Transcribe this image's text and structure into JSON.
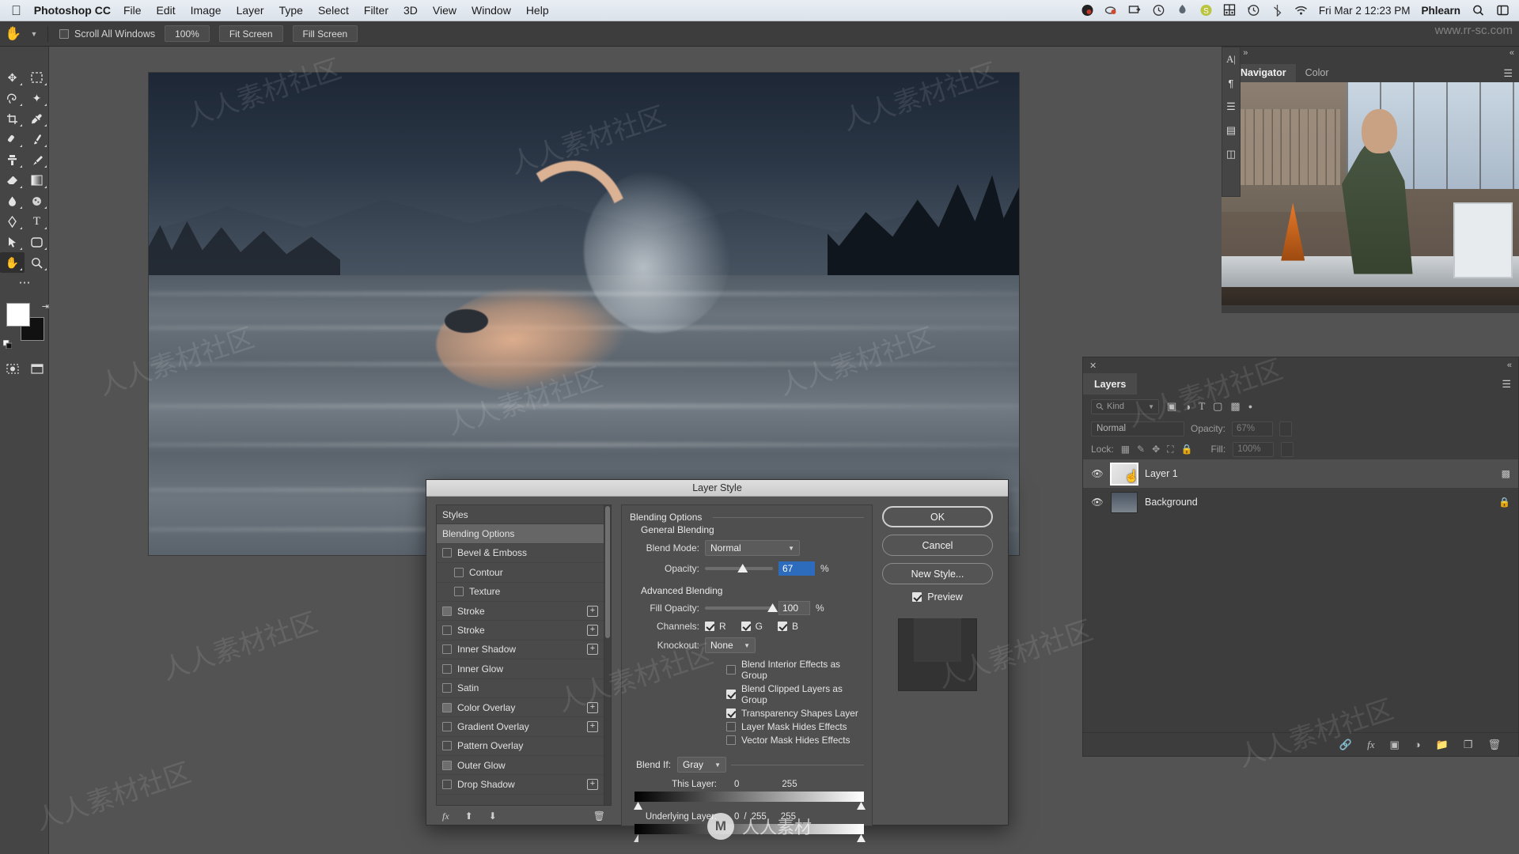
{
  "menubar": {
    "apple_icon": "apple-icon",
    "app_name": "Photoshop CC",
    "items": [
      "File",
      "Edit",
      "Image",
      "Layer",
      "Type",
      "Select",
      "Filter",
      "3D",
      "View",
      "Window",
      "Help"
    ],
    "status_icons": [
      "dropbox-icon",
      "cloud-sync-icon",
      "display-icon",
      "clock-icon",
      "battery-icon",
      "skype-icon",
      "grid-icon",
      "time-machine-icon",
      "bluetooth-icon",
      "wifi-icon"
    ],
    "clock": "Fri Mar 2  12:23 PM",
    "user": "Phlearn",
    "trailing_icons": [
      "search-icon",
      "control-center-icon"
    ]
  },
  "options_bar": {
    "tool_icon": "hand-tool-icon",
    "caret_icon": "chevron-down-icon",
    "scroll_all_windows": {
      "label": "Scroll All Windows",
      "checked": false
    },
    "buttons": [
      "100%",
      "Fit Screen",
      "Fill Screen"
    ]
  },
  "toolbar": {
    "tools": [
      "move-tool-icon",
      "marquee-tool-icon",
      "lasso-tool-icon",
      "magic-wand-tool-icon",
      "crop-tool-icon",
      "eyedropper-tool-icon",
      "healing-brush-tool-icon",
      "brush-tool-icon",
      "clone-stamp-tool-icon",
      "history-brush-tool-icon",
      "eraser-tool-icon",
      "gradient-tool-icon",
      "blur-tool-icon",
      "dodge-tool-icon",
      "pen-tool-icon",
      "type-tool-icon",
      "path-selection-tool-icon",
      "rectangle-tool-icon",
      "hand-tool-icon",
      "zoom-tool-icon"
    ],
    "active_tool": "hand-tool-icon",
    "more_tools_icon": "ellipsis-icon",
    "foreground_color": "#ffffff",
    "background_color": "#111111",
    "swap_colors_icon": "swap-colors-icon",
    "default_colors_icon": "default-colors-icon",
    "quick_mask_icon": "quick-mask-icon",
    "screen_mode_icon": "screen-mode-icon"
  },
  "navigator_panel": {
    "close_icon": "close-icon",
    "expand_icon": "expand-icon",
    "collapse_icon": "collapse-panel-icon",
    "tabs": [
      {
        "label": "Navigator",
        "selected": true
      },
      {
        "label": "Color",
        "selected": false
      }
    ],
    "menu_icon": "panel-menu-icon",
    "rail_icons": [
      "character-icon",
      "paragraph-icon",
      "layer-comps-icon",
      "properties-icon",
      "adjustments-icon"
    ]
  },
  "layers_panel": {
    "close_icon": "close-icon",
    "collapse_icon": "collapse-panel-icon",
    "tab_label": "Layers",
    "menu_icon": "panel-menu-icon",
    "filter": {
      "search_icon": "search-icon",
      "kind_label": "Kind",
      "caret_icon": "chevron-down-icon",
      "filter_icons": [
        "pixel-filter-icon",
        "adjustment-filter-icon",
        "type-filter-icon",
        "shape-filter-icon",
        "smart-object-filter-icon"
      ],
      "toggle_icon": "filter-toggle-icon"
    },
    "blend_mode": "Normal",
    "opacity_label": "Opacity:",
    "opacity_value": "67%",
    "lock_label": "Lock:",
    "lock_icons": [
      "lock-transparency-icon",
      "lock-image-icon",
      "lock-position-icon",
      "lock-artboard-icon",
      "lock-all-icon"
    ],
    "fill_label": "Fill:",
    "fill_value": "100%",
    "layers": [
      {
        "name": "Layer 1",
        "visible_icon": "eye-icon",
        "selected": true,
        "right_icon": "smart-object-badge-icon"
      },
      {
        "name": "Background",
        "visible_icon": "eye-icon",
        "selected": false,
        "right_icon": "lock-icon"
      }
    ],
    "bottom_icons": [
      "link-layers-icon",
      "layer-fx-icon",
      "add-mask-icon",
      "adjustment-layer-icon",
      "new-group-icon",
      "new-layer-icon",
      "delete-layer-icon"
    ],
    "cursor_icon": "pointing-hand-cursor-icon"
  },
  "layer_style_dialog": {
    "title": "Layer Style",
    "styles_header": "Styles",
    "styles_list": [
      {
        "label": "Blending Options",
        "type": "header-selected",
        "checkbox": null,
        "plus": false,
        "indent": false
      },
      {
        "label": "Bevel & Emboss",
        "checkbox": false,
        "plus": false,
        "indent": false
      },
      {
        "label": "Contour",
        "checkbox": false,
        "plus": false,
        "indent": true
      },
      {
        "label": "Texture",
        "checkbox": false,
        "plus": false,
        "indent": true
      },
      {
        "label": "Stroke",
        "checkbox": false,
        "plus": true,
        "indent": false
      },
      {
        "label": "Stroke",
        "checkbox": false,
        "plus": true,
        "indent": false
      },
      {
        "label": "Inner Shadow",
        "checkbox": false,
        "plus": true,
        "indent": false
      },
      {
        "label": "Inner Glow",
        "checkbox": false,
        "plus": false,
        "indent": false
      },
      {
        "label": "Satin",
        "checkbox": false,
        "plus": false,
        "indent": false
      },
      {
        "label": "Color Overlay",
        "checkbox": false,
        "plus": true,
        "indent": false
      },
      {
        "label": "Gradient Overlay",
        "checkbox": false,
        "plus": true,
        "indent": false
      },
      {
        "label": "Pattern Overlay",
        "checkbox": false,
        "plus": false,
        "indent": false
      },
      {
        "label": "Outer Glow",
        "checkbox": false,
        "plus": false,
        "indent": false
      },
      {
        "label": "Drop Shadow",
        "checkbox": false,
        "plus": true,
        "indent": false
      }
    ],
    "styles_footer_icons": [
      "fx-icon",
      "move-up-icon",
      "move-down-icon",
      "delete-effect-icon"
    ],
    "blending": {
      "section_title": "Blending Options",
      "general_title": "General Blending",
      "blend_mode_label": "Blend Mode:",
      "blend_mode_value": "Normal",
      "opacity_label": "Opacity:",
      "opacity_value": "67",
      "opacity_unit": "%",
      "advanced_title": "Advanced Blending",
      "fill_opacity_label": "Fill Opacity:",
      "fill_opacity_value": "100",
      "fill_opacity_unit": "%",
      "channels_label": "Channels:",
      "channels": [
        {
          "label": "R",
          "checked": true
        },
        {
          "label": "G",
          "checked": true
        },
        {
          "label": "B",
          "checked": true
        }
      ],
      "knockout_label": "Knockout:",
      "knockout_value": "None",
      "checkboxes": [
        {
          "label": "Blend Interior Effects as Group",
          "checked": false
        },
        {
          "label": "Blend Clipped Layers as Group",
          "checked": true
        },
        {
          "label": "Transparency Shapes Layer",
          "checked": true
        },
        {
          "label": "Layer Mask Hides Effects",
          "checked": false
        },
        {
          "label": "Vector Mask Hides Effects",
          "checked": false
        }
      ],
      "blend_if_label": "Blend If:",
      "blend_if_value": "Gray",
      "this_layer_label": "This Layer:",
      "this_layer_low": "0",
      "this_layer_high": "255",
      "underlying_layer_label": "Underlying Layer:",
      "underlying_low": "0",
      "underlying_sep": "/",
      "underlying_mid": "255",
      "underlying_high": "255"
    },
    "buttons": {
      "ok": "OK",
      "cancel": "Cancel",
      "new_style": "New Style...",
      "preview_label": "Preview",
      "preview_checked": true
    }
  },
  "watermarks": {
    "tile_text": "人人素材社区",
    "brand_letter": "М",
    "brand_text": "人人素材",
    "top_right": "www.rr-sc.com"
  }
}
